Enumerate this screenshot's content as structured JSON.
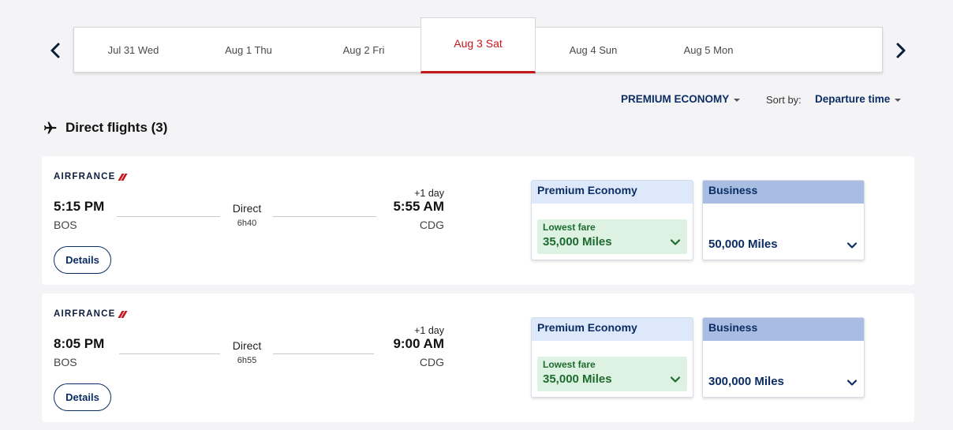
{
  "dates": [
    {
      "label": "Jul 31 Wed"
    },
    {
      "label": "Aug 1 Thu"
    },
    {
      "label": "Aug 2 Fri"
    },
    {
      "label": "Aug 3 Sat",
      "active": true
    },
    {
      "label": "Aug 4 Sun"
    },
    {
      "label": "Aug 5 Mon"
    }
  ],
  "filters": {
    "cabin": "PREMIUM ECONOMY",
    "sort_label": "Sort by:",
    "sort_value": "Departure time"
  },
  "section": {
    "title": "Direct flights (3)",
    "icon": "airplane-icon"
  },
  "airline": {
    "name": "AIRFRANCE"
  },
  "flights": [
    {
      "dep_time": "5:15 PM",
      "dep_code": "BOS",
      "arr_time": "5:55 AM",
      "arr_code": "CDG",
      "day_offset": "+1 day",
      "stops": "Direct",
      "duration": "6h40",
      "details_label": "Details",
      "premium": {
        "title": "Premium Economy",
        "badge": "Lowest fare",
        "miles": "35,000 Miles"
      },
      "business": {
        "title": "Business",
        "miles": "50,000 Miles"
      }
    },
    {
      "dep_time": "8:05 PM",
      "dep_code": "BOS",
      "arr_time": "9:00 AM",
      "arr_code": "CDG",
      "day_offset": "+1 day",
      "stops": "Direct",
      "duration": "6h55",
      "details_label": "Details",
      "premium": {
        "title": "Premium Economy",
        "badge": "Lowest fare",
        "miles": "35,000 Miles"
      },
      "business": {
        "title": "Business",
        "miles": "300,000 Miles"
      }
    }
  ],
  "colors": {
    "brand_red": "#c4161c",
    "navy": "#0c2d64",
    "fare_green": "#1d6b2e",
    "pe_header": "#dde8fb",
    "business_header": "#a9bde3"
  }
}
